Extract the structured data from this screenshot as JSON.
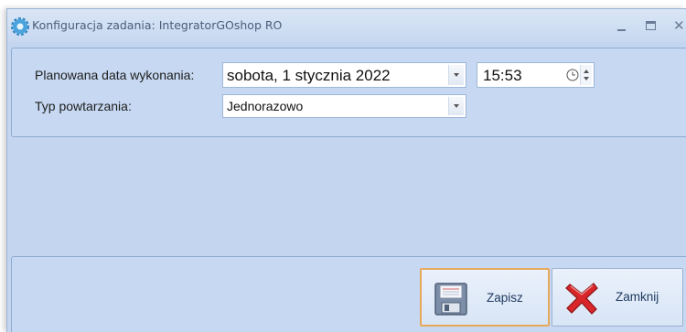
{
  "window": {
    "title": "Konfiguracja zadania: IntegratorGOshop RO"
  },
  "form": {
    "planned_date_label": "Planowana data wykonania:",
    "planned_date_value": "sobota, 1 stycznia 2022",
    "time_value": "15:53",
    "repeat_type_label": "Typ powtarzania:",
    "repeat_type_value": "Jednorazowo"
  },
  "buttons": {
    "save_label": "Zapisz",
    "close_label": "Zamknij"
  },
  "colors": {
    "window_background": "#c3d5ef",
    "panel_background": "#c7d9f2",
    "save_button_highlight": "#e8a85a",
    "close_icon_red": "#d8262a"
  },
  "icons": {
    "app": "gear-icon",
    "time": "clock-icon",
    "save": "floppy-disk-icon",
    "close": "red-x-icon"
  }
}
